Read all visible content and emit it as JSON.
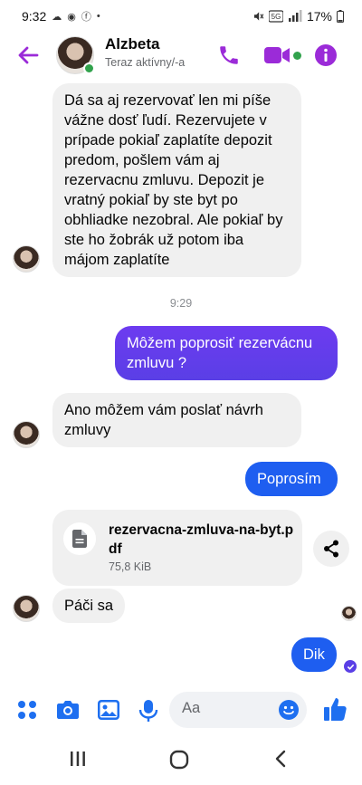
{
  "status_bar": {
    "time": "9:32",
    "battery": "17%",
    "left_icons": [
      "chat-icon",
      "cloud-icon",
      "facebook-icon",
      "dot-icon"
    ],
    "right_icons": [
      "mute-icon",
      "5g-icon",
      "signal-icon",
      "battery-icon"
    ]
  },
  "header": {
    "name": "Alzbeta",
    "presence": "Teraz aktívny/-a",
    "accent_color": "#9b2bd8",
    "online_color": "#31a24c"
  },
  "messages": [
    {
      "from": "them",
      "text": "Dá sa aj rezervovať len mi píše vážne dosť ľudí. Rezervujete v prípade pokiaľ zaplatíte depozit predom, pošlem vám aj rezervacnu zmluvu. Depozit je vratný pokiaľ by ste byt po obhliadke nezobral. Ale pokiaľ by ste ho žobrák už potom iba májom zaplatíte"
    },
    {
      "from": "timestamp",
      "text": "9:29"
    },
    {
      "from": "me",
      "text": "Môžem poprosiť rezervácnu zmluvu ?"
    },
    {
      "from": "them",
      "text": "Ano môžem vám poslať návrh zmluvy"
    },
    {
      "from": "me",
      "text": "Poprosím"
    },
    {
      "from": "them",
      "type": "file",
      "file_name": "rezervacna-zmluva-na-byt.pdf",
      "file_size": "75,8 KiB"
    },
    {
      "from": "them",
      "text": "Páči sa"
    },
    {
      "from": "me",
      "text": "Dik"
    }
  ],
  "composer": {
    "placeholder": "Aa",
    "icons": [
      "menu-grid-icon",
      "camera-icon",
      "gallery-icon",
      "microphone-icon",
      "emoji-icon",
      "thumbs-up-icon"
    ],
    "accent_color": "#1e6ff0"
  },
  "colors": {
    "outgoing_bubble": "#5a3fe6",
    "outgoing_bubble_blue": "#1e5ef0",
    "incoming_bubble": "#f0f0f0"
  }
}
